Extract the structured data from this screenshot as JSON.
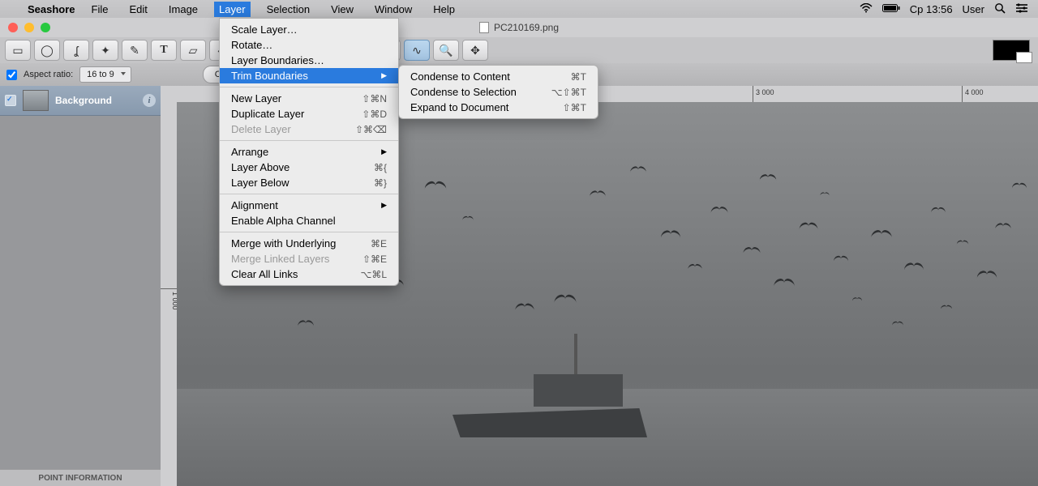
{
  "menubar": {
    "app": "Seashore",
    "items": [
      "File",
      "Edit",
      "Image",
      "Layer",
      "Selection",
      "View",
      "Window",
      "Help"
    ],
    "open_index": 3,
    "clock": "Ср 13:56",
    "user": "User"
  },
  "window": {
    "title": "PC210169.png"
  },
  "toolbar_icons": [
    "rect-select",
    "ellipse-select",
    "lasso",
    "wand",
    "brush",
    "text",
    "eraser",
    "bucket",
    "gradient",
    "",
    "pointer",
    "hand",
    "clone",
    "",
    "eyedropper",
    "smudge",
    "zoom",
    "move"
  ],
  "optionbar": {
    "aspect_label": "Aspect ratio:",
    "aspect_value": "16 to 9",
    "crop_button": "Crop Image"
  },
  "layers": {
    "items": [
      {
        "name": "Background"
      }
    ],
    "footer": "POINT INFORMATION"
  },
  "rulers": {
    "h": [
      {
        "pos": 710,
        "label": "3 000"
      },
      {
        "pos": 968,
        "label": "4 000"
      }
    ],
    "v": [
      {
        "pos": 230,
        "label": "1 000"
      }
    ]
  },
  "layer_menu": {
    "groups": [
      [
        {
          "label": "Scale Layer…",
          "shortcut": ""
        },
        {
          "label": "Rotate…",
          "shortcut": ""
        },
        {
          "label": "Layer Boundaries…",
          "shortcut": ""
        },
        {
          "label": "Trim Boundaries",
          "submenu": true,
          "hover": true
        }
      ],
      [
        {
          "label": "New Layer",
          "shortcut": "⇧⌘N"
        },
        {
          "label": "Duplicate Layer",
          "shortcut": "⇧⌘D"
        },
        {
          "label": "Delete Layer",
          "shortcut": "⇧⌘⌫",
          "disabled": true
        }
      ],
      [
        {
          "label": "Arrange",
          "submenu": true
        },
        {
          "label": "Layer Above",
          "shortcut": "⌘{"
        },
        {
          "label": "Layer Below",
          "shortcut": "⌘}"
        }
      ],
      [
        {
          "label": "Alignment",
          "submenu": true
        },
        {
          "label": "Enable Alpha Channel",
          "shortcut": ""
        }
      ],
      [
        {
          "label": "Merge with Underlying",
          "shortcut": "⌘E"
        },
        {
          "label": "Merge Linked Layers",
          "shortcut": "⇧⌘E",
          "disabled": true
        },
        {
          "label": "Clear All Links",
          "shortcut": "⌥⌘L"
        }
      ]
    ]
  },
  "trim_submenu": [
    {
      "label": "Condense to Content",
      "shortcut": "⌘T"
    },
    {
      "label": "Condense to Selection",
      "shortcut": "⌥⇧⌘T"
    },
    {
      "label": "Expand to Document",
      "shortcut": "⇧⌘T"
    }
  ]
}
